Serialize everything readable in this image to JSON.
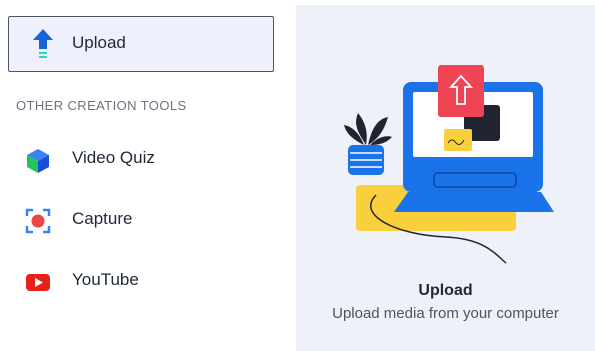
{
  "sidebar": {
    "upload_label": "Upload",
    "section_title": "OTHER CREATION TOOLS",
    "tools": [
      {
        "label": "Video Quiz",
        "icon": "cube-icon"
      },
      {
        "label": "Capture",
        "icon": "capture-icon"
      },
      {
        "label": "YouTube",
        "icon": "youtube-icon"
      }
    ]
  },
  "preview": {
    "title": "Upload",
    "subtitle": "Upload media from your computer"
  },
  "colors": {
    "accent_blue": "#1a73e8",
    "upload_red": "#ef4444",
    "yellow": "#f9cf3b",
    "youtube_red": "#e62117"
  }
}
